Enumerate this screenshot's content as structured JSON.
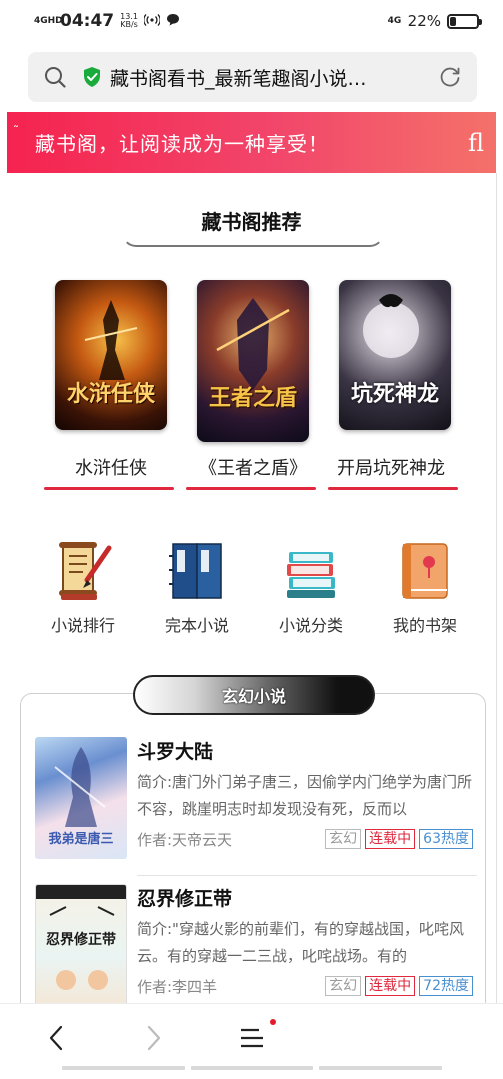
{
  "status_bar": {
    "signal": "4GHD",
    "time": "04:47",
    "speed_value": "13.1",
    "speed_unit": "KB/s",
    "network": "4G",
    "battery_pct": "22%",
    "battery_level": 0.22
  },
  "address_bar": {
    "title": "藏书阁看书_最新笔趣阁小说…",
    "icons": [
      "search-icon",
      "secure-shield-icon",
      "reload-icon"
    ],
    "shield_color": "#1aab3c"
  },
  "banner": {
    "text": "藏书阁，让阅读成为一种享受！",
    "right_glyph": "fl",
    "color": "#f5234f"
  },
  "recommend": {
    "title": "藏书阁推荐",
    "books": [
      {
        "name": "水浒任侠",
        "cover_title": "水浒任侠"
      },
      {
        "name": "《王者之盾》",
        "cover_title": "王者之盾"
      },
      {
        "name": "开局坑死神龙",
        "cover_title": "坑死神龙"
      }
    ],
    "accent": "#e0283f"
  },
  "quick_nav": [
    {
      "label": "小说排行",
      "icon": "ranking-scroll-icon"
    },
    {
      "label": "完本小说",
      "icon": "completed-books-icon"
    },
    {
      "label": "小说分类",
      "icon": "book-stack-icon"
    },
    {
      "label": "我的书架",
      "icon": "bookshelf-icon"
    }
  ],
  "category": {
    "tab_label": "玄幻小说",
    "books": [
      {
        "title": "斗罗大陆",
        "desc": "简介:唐门外门弟子唐三，因偷学内门绝学为唐门所不容，跳崖明志时却发现没有死，反而以",
        "author": "作者:天帝云天",
        "genre": "玄幻",
        "status": "连载中",
        "heat": "63热度",
        "cover_text": "我弟是唐三"
      },
      {
        "title": "忍界修正带",
        "desc": "简介:\"穿越火影的前辈们，有的穿越战国，叱咤风云。有的穿越一二三战，叱咤战场。有的",
        "author": "作者:李四羊",
        "genre": "玄幻",
        "status": "连载中",
        "heat": "72热度",
        "cover_text": "忍界修正带"
      }
    ]
  },
  "bottom_nav": {
    "back": "back-icon",
    "forward": "forward-icon",
    "menu": "menu-icon"
  }
}
